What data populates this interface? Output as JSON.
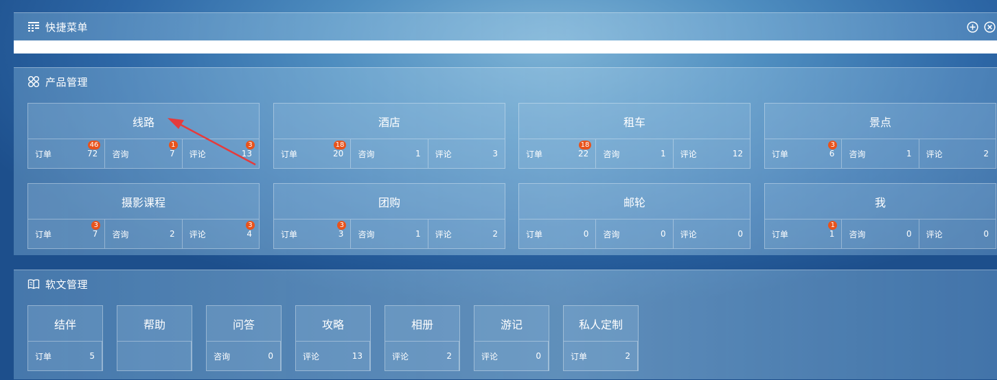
{
  "quick_menu": {
    "title": "快捷菜单"
  },
  "product": {
    "title": "产品管理",
    "cards": [
      {
        "name": "线路",
        "stats": [
          {
            "label": "订单",
            "value": "72",
            "badge": "46"
          },
          {
            "label": "咨询",
            "value": "7",
            "badge": "1"
          },
          {
            "label": "评论",
            "value": "13",
            "badge": "3"
          }
        ]
      },
      {
        "name": "酒店",
        "stats": [
          {
            "label": "订单",
            "value": "20",
            "badge": "18"
          },
          {
            "label": "咨询",
            "value": "1",
            "badge": ""
          },
          {
            "label": "评论",
            "value": "3",
            "badge": ""
          }
        ]
      },
      {
        "name": "租车",
        "stats": [
          {
            "label": "订单",
            "value": "22",
            "badge": "18"
          },
          {
            "label": "咨询",
            "value": "1",
            "badge": ""
          },
          {
            "label": "评论",
            "value": "12",
            "badge": ""
          }
        ]
      },
      {
        "name": "景点",
        "stats": [
          {
            "label": "订单",
            "value": "6",
            "badge": "3"
          },
          {
            "label": "咨询",
            "value": "1",
            "badge": ""
          },
          {
            "label": "评论",
            "value": "2",
            "badge": ""
          }
        ]
      },
      {
        "name": "摄影课程",
        "stats": [
          {
            "label": "订单",
            "value": "7",
            "badge": "3"
          },
          {
            "label": "咨询",
            "value": "2",
            "badge": ""
          },
          {
            "label": "评论",
            "value": "4",
            "badge": "3"
          }
        ]
      },
      {
        "name": "团购",
        "stats": [
          {
            "label": "订单",
            "value": "3",
            "badge": "3"
          },
          {
            "label": "咨询",
            "value": "1",
            "badge": ""
          },
          {
            "label": "评论",
            "value": "2",
            "badge": ""
          }
        ]
      },
      {
        "name": "邮轮",
        "stats": [
          {
            "label": "订单",
            "value": "0",
            "badge": ""
          },
          {
            "label": "咨询",
            "value": "0",
            "badge": ""
          },
          {
            "label": "评论",
            "value": "0",
            "badge": ""
          }
        ]
      },
      {
        "name": "我",
        "stats": [
          {
            "label": "订单",
            "value": "1",
            "badge": "1"
          },
          {
            "label": "咨询",
            "value": "0",
            "badge": ""
          },
          {
            "label": "评论",
            "value": "0",
            "badge": ""
          }
        ]
      }
    ]
  },
  "soft": {
    "title": "软文管理",
    "cards": [
      {
        "name": "结伴",
        "stat": {
          "label": "订单",
          "value": "5"
        }
      },
      {
        "name": "帮助",
        "stat": {
          "label": "",
          "value": ""
        }
      },
      {
        "name": "问答",
        "stat": {
          "label": "咨询",
          "value": "0"
        }
      },
      {
        "name": "攻略",
        "stat": {
          "label": "评论",
          "value": "13"
        }
      },
      {
        "name": "相册",
        "stat": {
          "label": "评论",
          "value": "2"
        }
      },
      {
        "name": "游记",
        "stat": {
          "label": "评论",
          "value": "0"
        }
      },
      {
        "name": "私人定制",
        "stat": {
          "label": "订单",
          "value": "2"
        }
      }
    ]
  },
  "colors": {
    "badge": "#e8531c",
    "arrow": "#e63b3b"
  }
}
